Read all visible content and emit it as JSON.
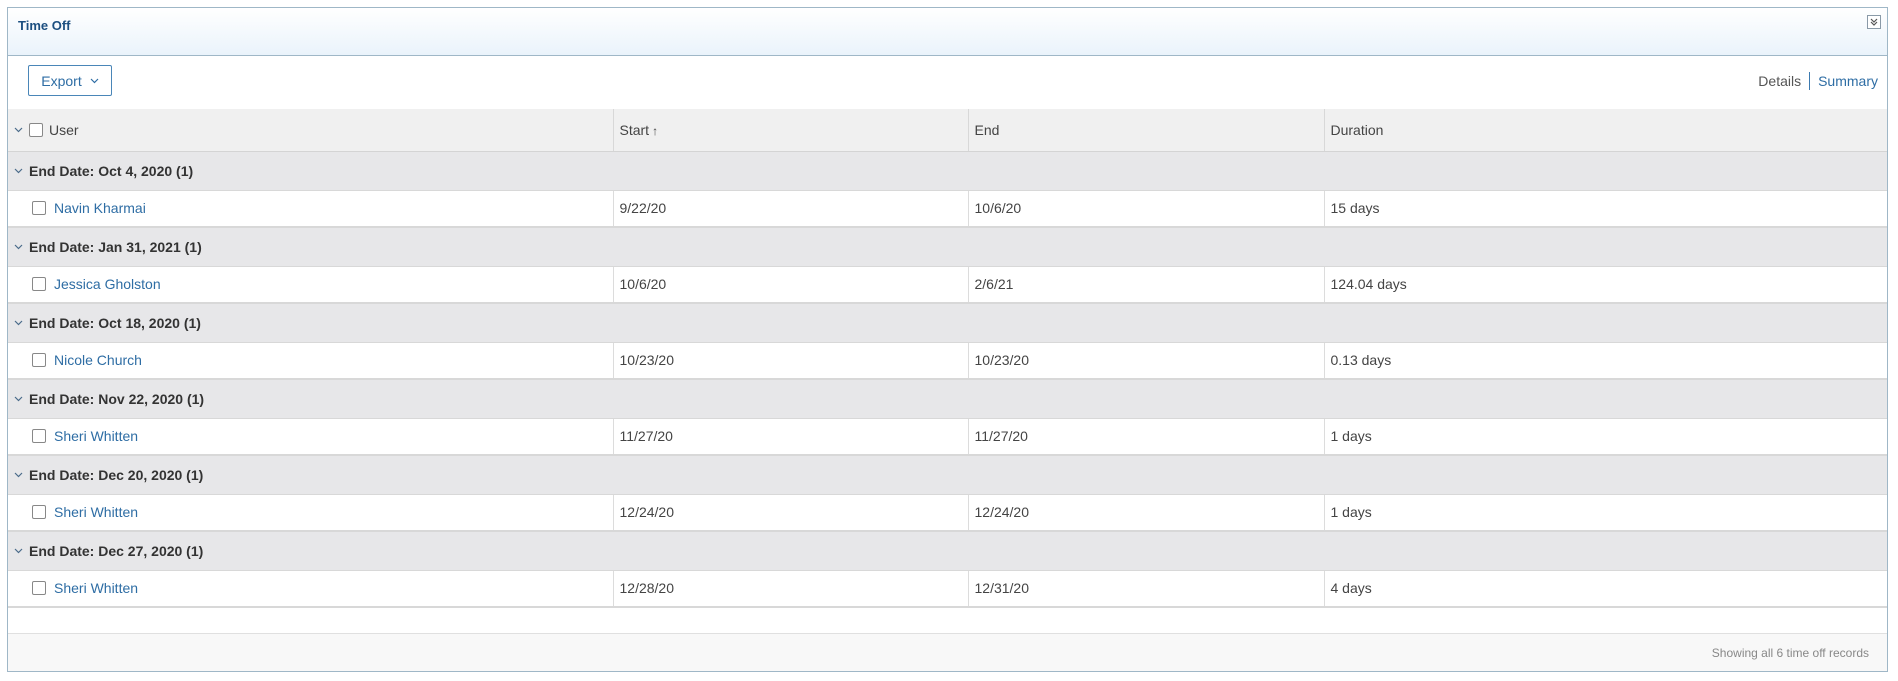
{
  "panel": {
    "title": "Time Off"
  },
  "toolbar": {
    "export_label": "Export",
    "details_label": "Details",
    "summary_label": "Summary"
  },
  "columns": {
    "user": "User",
    "start": "Start",
    "start_sort": "↑",
    "end": "End",
    "duration": "Duration"
  },
  "groups": [
    {
      "label": "End Date: Oct 4, 2020 (1)",
      "row": {
        "user": "Navin Kharmai",
        "start": "9/22/20",
        "end": "10/6/20",
        "duration": "15 days"
      }
    },
    {
      "label": "End Date: Jan 31, 2021 (1)",
      "row": {
        "user": "Jessica Gholston",
        "start": "10/6/20",
        "end": "2/6/21",
        "duration": "124.04 days"
      }
    },
    {
      "label": "End Date: Oct 18, 2020 (1)",
      "row": {
        "user": "Nicole Church",
        "start": "10/23/20",
        "end": "10/23/20",
        "duration": "0.13 days"
      }
    },
    {
      "label": "End Date: Nov 22, 2020 (1)",
      "row": {
        "user": "Sheri Whitten",
        "start": "11/27/20",
        "end": "11/27/20",
        "duration": "1 days"
      }
    },
    {
      "label": "End Date: Dec 20, 2020 (1)",
      "row": {
        "user": "Sheri Whitten",
        "start": "12/24/20",
        "end": "12/24/20",
        "duration": "1 days"
      }
    },
    {
      "label": "End Date: Dec 27, 2020 (1)",
      "row": {
        "user": "Sheri Whitten",
        "start": "12/28/20",
        "end": "12/31/20",
        "duration": "4 days"
      }
    }
  ],
  "footer": {
    "text": "Showing all 6 time off records"
  },
  "colors": {
    "accent": "#2e6da4",
    "header_bg": "#f0f0f0",
    "group_bg": "#e7e7e9"
  }
}
